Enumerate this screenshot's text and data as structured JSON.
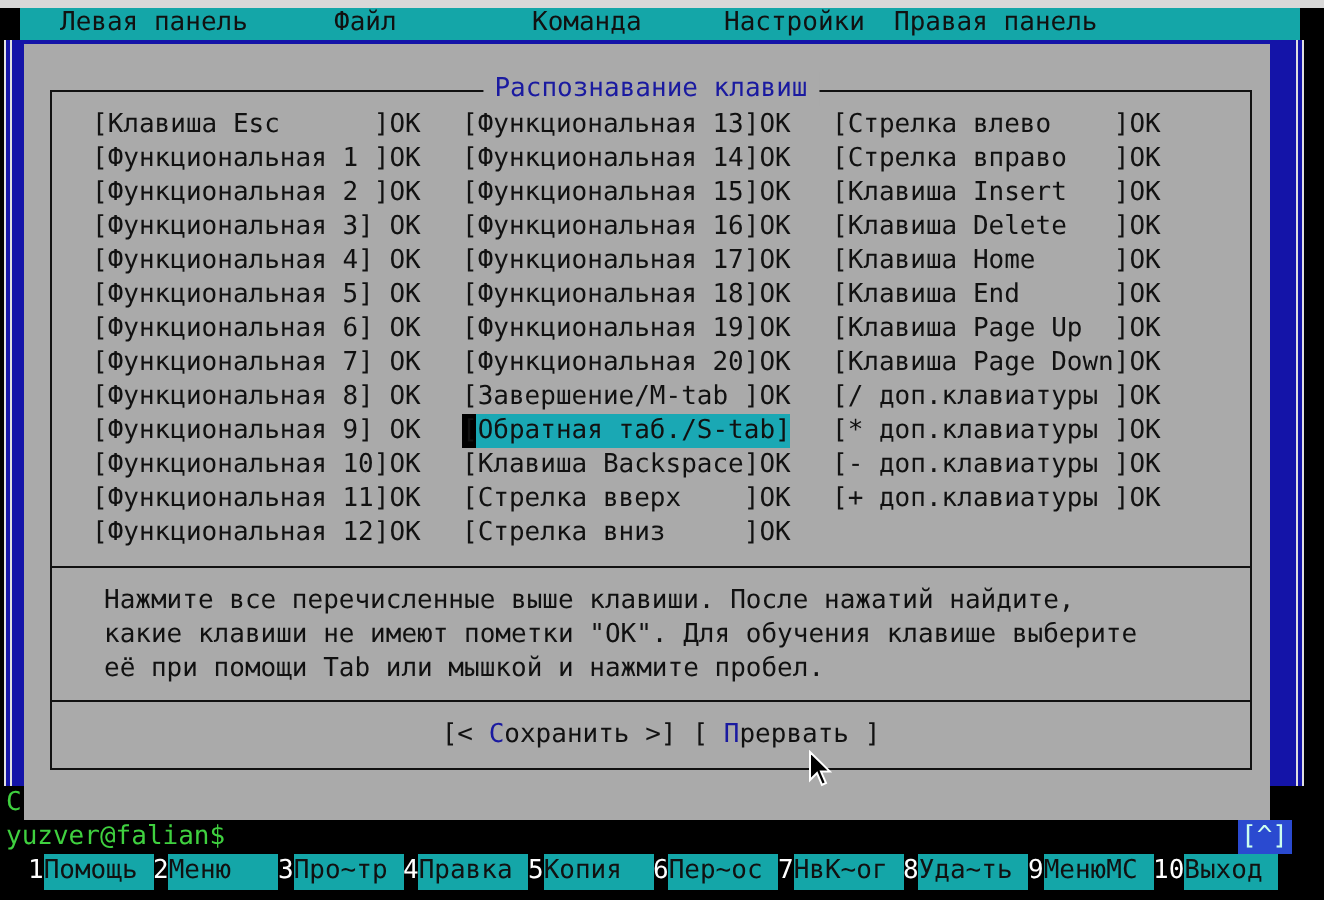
{
  "menu_bar": [
    {
      "label": "Левая панель"
    },
    {
      "label": "Файл"
    },
    {
      "label": "Команда"
    },
    {
      "label": "Настройки"
    },
    {
      "label": "Правая панель"
    }
  ],
  "dialog": {
    "title": "Распознавание клавиш",
    "key_columns": [
      {
        "keys": [
          {
            "text": "[Клавиша Esc      ]OK",
            "selected": false
          },
          {
            "text": "[Функциональная 1 ]OK",
            "selected": false
          },
          {
            "text": "[Функциональная 2 ]OK",
            "selected": false
          },
          {
            "text": "[Функциональная 3] OK",
            "selected": false
          },
          {
            "text": "[Функциональная 4] OK",
            "selected": false
          },
          {
            "text": "[Функциональная 5] OK",
            "selected": false
          },
          {
            "text": "[Функциональная 6] OK",
            "selected": false
          },
          {
            "text": "[Функциональная 7] OK",
            "selected": false
          },
          {
            "text": "[Функциональная 8] OK",
            "selected": false
          },
          {
            "text": "[Функциональная 9] OK",
            "selected": false
          },
          {
            "text": "[Функциональная 10]OK",
            "selected": false
          },
          {
            "text": "[Функциональная 11]OK",
            "selected": false
          },
          {
            "text": "[Функциональная 12]OK",
            "selected": false
          }
        ]
      },
      {
        "keys": [
          {
            "text": "[Функциональная 13]OK",
            "selected": false
          },
          {
            "text": "[Функциональная 14]OK",
            "selected": false
          },
          {
            "text": "[Функциональная 15]OK",
            "selected": false
          },
          {
            "text": "[Функциональная 16]OK",
            "selected": false
          },
          {
            "text": "[Функциональная 17]OK",
            "selected": false
          },
          {
            "text": "[Функциональная 18]OK",
            "selected": false
          },
          {
            "text": "[Функциональная 19]OK",
            "selected": false
          },
          {
            "text": "[Функциональная 20]OK",
            "selected": false
          },
          {
            "text": "[Завершение/M-tab ]OK",
            "selected": false
          },
          {
            "text": "[Обратная таб./S-tab]",
            "selected": true
          },
          {
            "text": "[Клавиша Backspace]OK",
            "selected": false
          },
          {
            "text": "[Стрелка вверх    ]OK",
            "selected": false
          },
          {
            "text": "[Стрелка вниз     ]OK",
            "selected": false
          }
        ]
      },
      {
        "keys": [
          {
            "text": "[Стрелка влево    ]OK",
            "selected": false
          },
          {
            "text": "[Стрелка вправо   ]OK",
            "selected": false
          },
          {
            "text": "[Клавиша Insert   ]OK",
            "selected": false
          },
          {
            "text": "[Клавиша Delete   ]OK",
            "selected": false
          },
          {
            "text": "[Клавиша Home     ]OK",
            "selected": false
          },
          {
            "text": "[Клавиша End      ]OK",
            "selected": false
          },
          {
            "text": "[Клавиша Page Up  ]OK",
            "selected": false
          },
          {
            "text": "[Клавиша Page Down]OK",
            "selected": false
          },
          {
            "text": "[/ доп.клавиатуры ]OK",
            "selected": false
          },
          {
            "text": "[* доп.клавиатуры ]OK",
            "selected": false
          },
          {
            "text": "[- доп.клавиатуры ]OK",
            "selected": false
          },
          {
            "text": "[+ доп.клавиатуры ]OK",
            "selected": false
          }
        ]
      }
    ],
    "instructions": "Нажмите все перечисленные выше клавиши. После нажатий найдите,\nкакие клавиши не имеют пометки \"OK\". Для обучения клавише выберите\neё при помощи Tab или мышкой и нажмите пробел.",
    "buttons": [
      {
        "before": "[< ",
        "hotkey": "С",
        "after": "охранить >]"
      },
      {
        "before": "[ ",
        "hotkey": "П",
        "after": "рервать ]"
      }
    ]
  },
  "terminal": {
    "previous_line": "C",
    "prompt": "yuzver@falian$",
    "scroll_hint": "[^]"
  },
  "function_keys": [
    {
      "num": "1",
      "label": "Помощь"
    },
    {
      "num": "2",
      "label": "Меню  "
    },
    {
      "num": "3",
      "label": "Про~тр"
    },
    {
      "num": "4",
      "label": "Правка"
    },
    {
      "num": "5",
      "label": "Копия "
    },
    {
      "num": "6",
      "label": "Пер~ос"
    },
    {
      "num": "7",
      "label": "НвК~ог"
    },
    {
      "num": "8",
      "label": "Уда~ть"
    },
    {
      "num": "9",
      "label": "МенюМС"
    },
    {
      "num": "10",
      "label": "Выход "
    }
  ]
}
